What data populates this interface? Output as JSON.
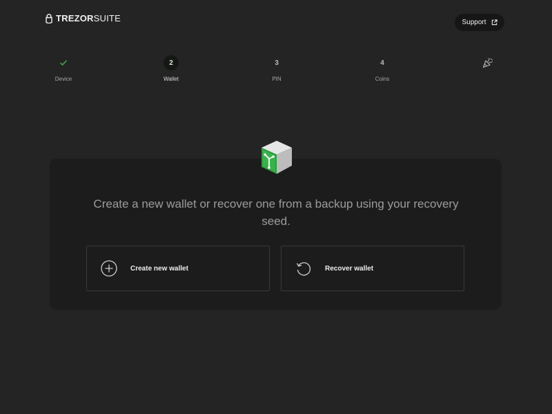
{
  "header": {
    "logo_bold": "TREZOR",
    "logo_light": "SUITE",
    "support_label": "Support"
  },
  "stepper": {
    "steps": [
      {
        "number": "✓",
        "label": "Device",
        "state": "done"
      },
      {
        "number": "2",
        "label": "Wallet",
        "state": "active"
      },
      {
        "number": "3",
        "label": "PIN",
        "state": "upcoming"
      },
      {
        "number": "4",
        "label": "Coins",
        "state": "upcoming"
      }
    ],
    "final_icon": "party-popper-icon"
  },
  "main": {
    "headline": "Create a new wallet or recover one from a backup using your recovery seed.",
    "options": [
      {
        "label": "Create new wallet",
        "icon": "plus-circle-icon"
      },
      {
        "label": "Recover wallet",
        "icon": "recover-arrow-icon"
      }
    ]
  },
  "colors": {
    "background": "#242424",
    "card": "#1c1c1c",
    "accent_green": "#2bb14a",
    "done_check": "#3fa64f"
  }
}
